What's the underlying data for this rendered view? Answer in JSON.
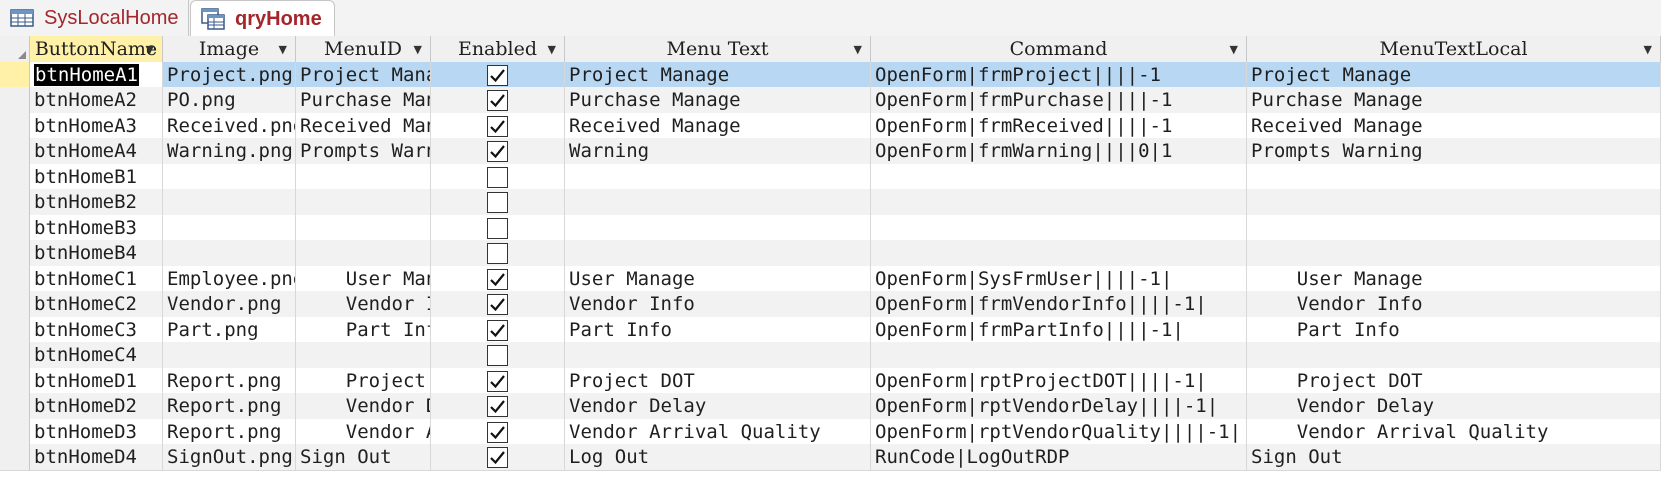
{
  "tabs": [
    {
      "label": "SysLocalHome",
      "icon": "table-icon",
      "active": false
    },
    {
      "label": "qryHome",
      "icon": "query-icon",
      "active": true
    }
  ],
  "columns": [
    "ButtonName",
    "Image",
    "MenuID",
    "Enabled",
    "Menu Text",
    "Command",
    "MenuTextLocal"
  ],
  "rows": [
    {
      "ButtonName": "btnHomeA1",
      "Image": "Project.png",
      "MenuID": "Project Manage",
      "Enabled": true,
      "MenuText": "Project Manage",
      "Command": "OpenForm|frmProject||||-1",
      "MenuTextLocal": "Project Manage"
    },
    {
      "ButtonName": "btnHomeA2",
      "Image": "PO.png",
      "MenuID": "Purchase Manage",
      "Enabled": true,
      "MenuText": "Purchase Manage",
      "Command": "OpenForm|frmPurchase||||-1",
      "MenuTextLocal": "Purchase Manage"
    },
    {
      "ButtonName": "btnHomeA3",
      "Image": "Received.png",
      "MenuID": "Received Manage",
      "Enabled": true,
      "MenuText": "Received Manage",
      "Command": "OpenForm|frmReceived||||-1",
      "MenuTextLocal": "Received Manage"
    },
    {
      "ButtonName": "btnHomeA4",
      "Image": "Warning.png",
      "MenuID": "Prompts Warning",
      "Enabled": true,
      "MenuText": "Warning",
      "Command": "OpenForm|frmWarning||||0|1",
      "MenuTextLocal": "Prompts Warning"
    },
    {
      "ButtonName": "btnHomeB1",
      "Image": "",
      "MenuID": "",
      "Enabled": false,
      "MenuText": "",
      "Command": "",
      "MenuTextLocal": ""
    },
    {
      "ButtonName": "btnHomeB2",
      "Image": "",
      "MenuID": "",
      "Enabled": false,
      "MenuText": "",
      "Command": "",
      "MenuTextLocal": ""
    },
    {
      "ButtonName": "btnHomeB3",
      "Image": "",
      "MenuID": "",
      "Enabled": false,
      "MenuText": "",
      "Command": "",
      "MenuTextLocal": ""
    },
    {
      "ButtonName": "btnHomeB4",
      "Image": "",
      "MenuID": "",
      "Enabled": false,
      "MenuText": "",
      "Command": "",
      "MenuTextLocal": ""
    },
    {
      "ButtonName": "btnHomeC1",
      "Image": "Employee.png",
      "MenuID": "    User Manage",
      "Enabled": true,
      "MenuText": "User Manage",
      "Command": "OpenForm|SysFrmUser||||-1|",
      "MenuTextLocal": "    User Manage"
    },
    {
      "ButtonName": "btnHomeC2",
      "Image": "Vendor.png",
      "MenuID": "    Vendor Info",
      "Enabled": true,
      "MenuText": "Vendor Info",
      "Command": "OpenForm|frmVendorInfo||||-1|",
      "MenuTextLocal": "    Vendor Info"
    },
    {
      "ButtonName": "btnHomeC3",
      "Image": "Part.png",
      "MenuID": "    Part Info",
      "Enabled": true,
      "MenuText": "Part Info",
      "Command": "OpenForm|frmPartInfo||||-1|",
      "MenuTextLocal": "    Part Info"
    },
    {
      "ButtonName": "btnHomeC4",
      "Image": "",
      "MenuID": "",
      "Enabled": false,
      "MenuText": "",
      "Command": "",
      "MenuTextLocal": ""
    },
    {
      "ButtonName": "btnHomeD1",
      "Image": "Report.png",
      "MenuID": "    Project DOT",
      "Enabled": true,
      "MenuText": "Project DOT",
      "Command": "OpenForm|rptProjectDOT||||-1|",
      "MenuTextLocal": "    Project DOT"
    },
    {
      "ButtonName": "btnHomeD2",
      "Image": "Report.png",
      "MenuID": "    Vendor Delay",
      "Enabled": true,
      "MenuText": "Vendor Delay",
      "Command": "OpenForm|rptVendorDelay||||-1|",
      "MenuTextLocal": "    Vendor Delay"
    },
    {
      "ButtonName": "btnHomeD3",
      "Image": "Report.png",
      "MenuID": "    Vendor Arrival Quality",
      "Enabled": true,
      "MenuText": "Vendor Arrival Quality",
      "Command": "OpenForm|rptVendorQuality||||-1|",
      "MenuTextLocal": "    Vendor Arrival Quality"
    },
    {
      "ButtonName": "btnHomeD4",
      "Image": "SignOut.png",
      "MenuID": "Sign Out",
      "Enabled": true,
      "MenuText": "Log Out",
      "Command": "RunCode|LogOutRDP",
      "MenuTextLocal": "Sign Out"
    }
  ],
  "current_row": 0,
  "colors": {
    "header_bg": "#f0f0f0",
    "current_row": "#b7d7f2",
    "sorted_header": "#fff2a8",
    "tab_text": "#a4262c"
  }
}
